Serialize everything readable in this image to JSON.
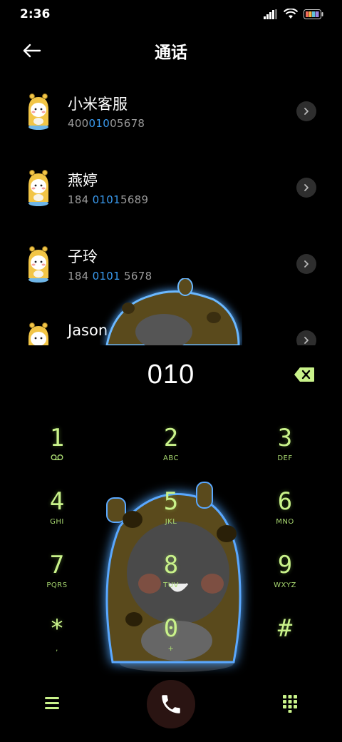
{
  "status_bar": {
    "time": "2:36",
    "icons": [
      "signal-icon",
      "wifi-icon",
      "battery-icon"
    ]
  },
  "header": {
    "title": "通话",
    "back_icon": "back-arrow-icon"
  },
  "contacts": [
    {
      "name": "小米客服",
      "number_parts": [
        "400",
        "010",
        "05678"
      ],
      "highlight_index": 1
    },
    {
      "name": "燕婷",
      "number_parts": [
        "184 ",
        "0101",
        "5689"
      ],
      "highlight_index": 1
    },
    {
      "name": "子玲",
      "number_parts": [
        "184 ",
        "0101",
        " 5678"
      ],
      "highlight_index": 1
    },
    {
      "name": "Jason",
      "number_parts": [
        "",
        "",
        ""
      ],
      "highlight_index": 1
    }
  ],
  "dialer": {
    "number": "010",
    "backspace_icon": "backspace-icon"
  },
  "keypad": [
    {
      "digit": "1",
      "letters": "voicemail",
      "letters_icon": "voicemail-icon"
    },
    {
      "digit": "2",
      "letters": "ABC"
    },
    {
      "digit": "3",
      "letters": "DEF"
    },
    {
      "digit": "4",
      "letters": "GHI"
    },
    {
      "digit": "5",
      "letters": "JKL"
    },
    {
      "digit": "6",
      "letters": "MNO"
    },
    {
      "digit": "7",
      "letters": "PQRS"
    },
    {
      "digit": "8",
      "letters": "TUV"
    },
    {
      "digit": "9",
      "letters": "WXYZ"
    },
    {
      "digit": "*",
      "letters": ","
    },
    {
      "digit": "0",
      "letters": "+"
    },
    {
      "digit": "#",
      "letters": ""
    }
  ],
  "bottom_bar": {
    "menu_icon": "menu-icon",
    "call_icon": "phone-icon",
    "keypad_icon": "dialpad-icon"
  },
  "colors": {
    "accent_green": "#c9f28a",
    "highlight_blue": "#3a9bf0",
    "call_button_bg": "#2a1412",
    "background": "#000000"
  }
}
